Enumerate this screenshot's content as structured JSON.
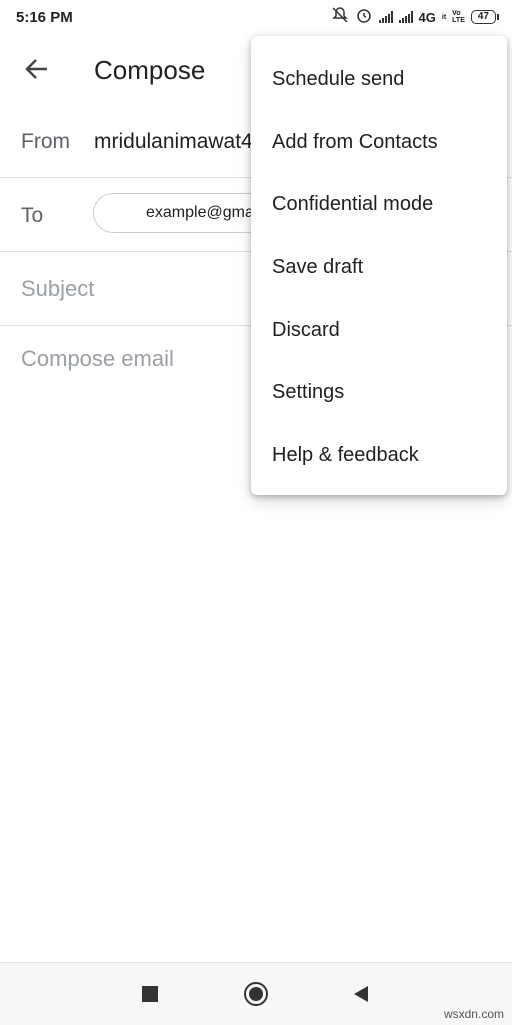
{
  "status_bar": {
    "time": "5:16 PM",
    "network": "4G",
    "network_sub": "it",
    "volte_top": "Vo",
    "volte_bottom": "LTE",
    "battery": "47",
    "icons": [
      "mute-icon",
      "alarm-icon",
      "signal-icon",
      "signal-icon"
    ]
  },
  "toolbar": {
    "title": "Compose",
    "back_icon": "arrow-back-icon"
  },
  "form": {
    "from_label": "From",
    "from_value": "mridulanimawat4",
    "to_label": "To",
    "to_chip": "example@gma",
    "subject_placeholder": "Subject",
    "body_placeholder": "Compose email"
  },
  "menu": {
    "items": [
      "Schedule send",
      "Add from Contacts",
      "Confidential mode",
      "Save draft",
      "Discard",
      "Settings",
      "Help & feedback"
    ]
  },
  "nav": {
    "buttons": [
      "recents-icon",
      "home-icon",
      "back-icon"
    ]
  },
  "watermark": "wsxdn.com"
}
